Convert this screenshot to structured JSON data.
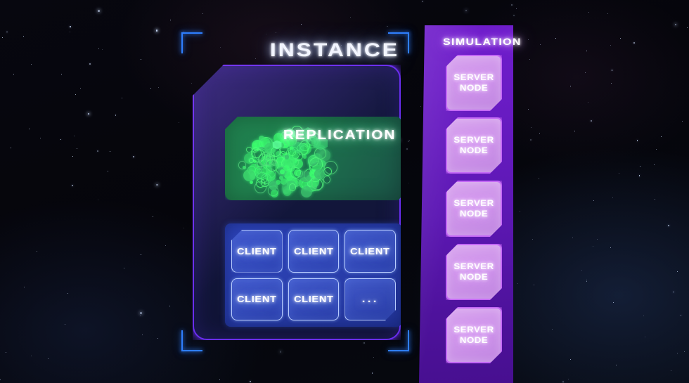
{
  "scene": {
    "background": "deep-space-starfield",
    "colors": {
      "space": "#05060c",
      "instance_accent": "#6a2df0",
      "bracket_accent": "#2f7fff",
      "replication_green": "#20804e",
      "client_blue": "#2a3fae",
      "simulation_purple": "#6b1cc6",
      "server_node_fill": "#cf97ea",
      "server_node_border": "#c469f5"
    }
  },
  "instance": {
    "title": "INSTANCE",
    "replication": {
      "title": "REPLICATION",
      "cluster_icon": "cell-cluster-icon"
    },
    "clients": {
      "items": [
        {
          "label": "CLIENT",
          "corner": "cut-tl"
        },
        {
          "label": "CLIENT",
          "corner": "none"
        },
        {
          "label": "CLIENT",
          "corner": "none"
        },
        {
          "label": "CLIENT",
          "corner": "none"
        },
        {
          "label": "CLIENT",
          "corner": "none"
        },
        {
          "label": "...",
          "corner": "cut-br"
        }
      ]
    }
  },
  "simulation": {
    "title": "SIMULATION",
    "nodes": [
      {
        "line1": "SERVER",
        "line2": "NODE"
      },
      {
        "line1": "SERVER",
        "line2": "NODE"
      },
      {
        "line1": "SERVER",
        "line2": "NODE"
      },
      {
        "line1": "SERVER",
        "line2": "NODE"
      },
      {
        "line1": "SERVER",
        "line2": "NODE"
      }
    ]
  }
}
